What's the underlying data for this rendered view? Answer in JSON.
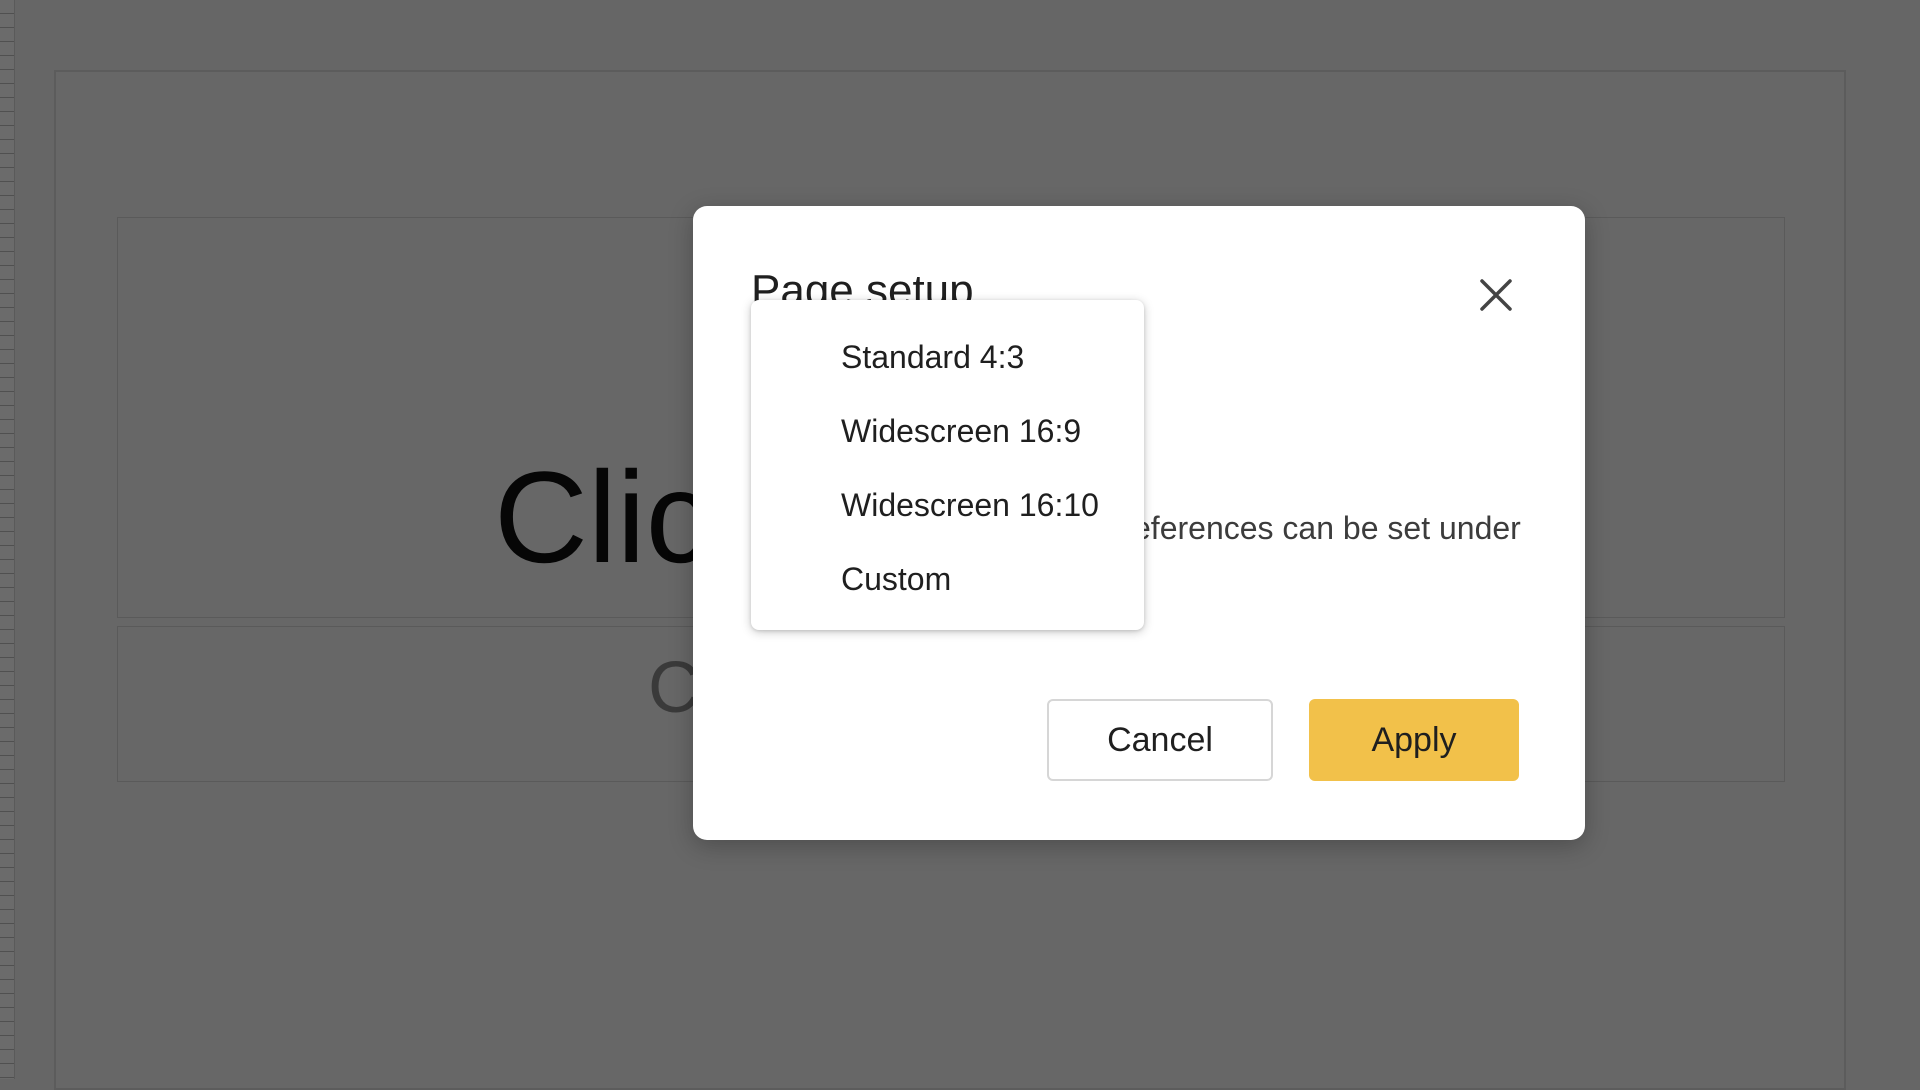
{
  "background": {
    "title_placeholder": "Clic",
    "subtitle_placeholder": "C"
  },
  "dialog": {
    "title": "Page setup",
    "body_text": "eferences can be set under",
    "close_icon": "close-icon",
    "cancel_label": "Cancel",
    "apply_label": "Apply",
    "apply_color": "#f2c14a"
  },
  "menu": {
    "items": [
      {
        "label": "Standard 4:3"
      },
      {
        "label": "Widescreen 16:9"
      },
      {
        "label": "Widescreen 16:10"
      },
      {
        "label": "Custom"
      }
    ]
  }
}
